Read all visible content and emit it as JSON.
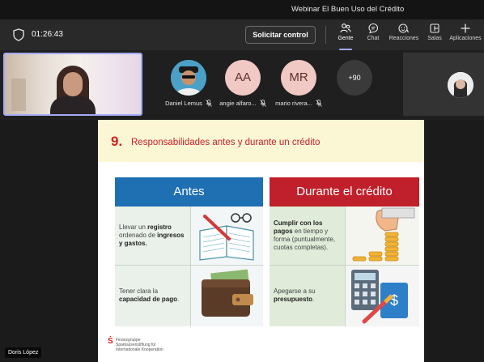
{
  "window": {
    "title": "Webinar El Buen Uso del Crédito"
  },
  "toolbar": {
    "timer": "01:26:43",
    "request_control": "Solicitar control",
    "items": [
      {
        "label": "Gente",
        "icon": "people-icon",
        "active": true
      },
      {
        "label": "Chat",
        "icon": "chat-icon"
      },
      {
        "label": "Reacciones",
        "icon": "reactions-icon"
      },
      {
        "label": "Salas",
        "icon": "rooms-icon"
      },
      {
        "label": "Aplicaciones",
        "icon": "add-apps-icon"
      }
    ]
  },
  "participants": [
    {
      "name": "Daniel Lemus",
      "initials": "",
      "icon": "mic-off-icon"
    },
    {
      "name": "angie alfaro...",
      "initials": "AA",
      "icon": "mic-off-icon"
    },
    {
      "name": "mario rivera...",
      "initials": "MR",
      "icon": "mic-off-icon"
    },
    {
      "name": "",
      "initials": "+90"
    }
  ],
  "slide": {
    "number": "9.",
    "title": "Responsabilidades antes y durante un crédito",
    "columns": [
      "Antes",
      "Durante el crédito"
    ],
    "antes": [
      {
        "plain1": "Llevar un ",
        "bold1": "registro",
        "plain2": " ordenado de ",
        "bold2": "ingresos y gastos."
      },
      {
        "plain1": "Tener clara la ",
        "bold1": "capacidad de pago",
        "plain2": ".",
        "bold2": ""
      }
    ],
    "durante": [
      {
        "bold1": "Cumplir con los pagos",
        "plain1": " en tiempo y forma (puntualmente, cuotas completas)."
      },
      {
        "plain1": "Apegarse a su ",
        "bold1": "presupuesto",
        "plain2": "."
      }
    ],
    "logo_lines": "Finanzgruppe\nSparkassenstiftung für\nInternationale Kooperation"
  },
  "presenter": {
    "name": "Doris López"
  },
  "colors": {
    "accent": "#a4aaf5",
    "blue": "#1f6fb3",
    "red": "#c0202b"
  }
}
